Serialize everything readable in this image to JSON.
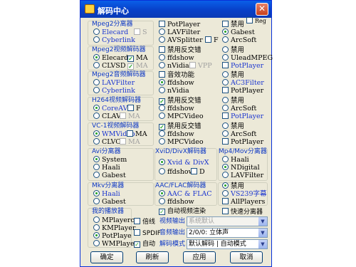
{
  "window": {
    "title": "解码中心",
    "reg": "Reg"
  },
  "g1": {
    "title": "Mpeg2分离器",
    "items": [
      "Elecard",
      "Cyberlink"
    ],
    "s": "S"
  },
  "g1b": {
    "items": [
      "PotPlayer",
      "LAVFilter",
      "AVSplitter"
    ],
    "f": "F"
  },
  "g1c": {
    "items": [
      "禁用",
      "Gabest",
      "ArcSoft"
    ]
  },
  "g2": {
    "title": "Mpeg2视频解码器",
    "items": [
      "Elecard",
      "CLVSD"
    ],
    "ma": "MA"
  },
  "g2b": {
    "items": [
      "禁用反交错",
      "ffdshow",
      "nVidia"
    ],
    "vpp": "VPP"
  },
  "g2c": {
    "items": [
      "禁用",
      "UleadMPEG",
      "PotPlayer"
    ]
  },
  "g3": {
    "title": "Mpeg2音频解码器",
    "items": [
      "LAVFilter",
      "Cyberlink"
    ]
  },
  "g3b": {
    "items": [
      "音效功能",
      "ffdshow",
      "nVidia"
    ]
  },
  "g3c": {
    "items": [
      "禁用",
      "AC3Filter",
      "PotPlayer"
    ]
  },
  "g4": {
    "title": "H264视频解码器",
    "items": [
      "CoreAVC",
      "CLAVC"
    ],
    "f": "F",
    "ma": "MA"
  },
  "g4b": {
    "items": [
      "禁用反交错",
      "ffdshow",
      "MPCVideo"
    ]
  },
  "g4c": {
    "items": [
      "禁用",
      "ArcSoft",
      "PotPlayer"
    ]
  },
  "g5": {
    "title": "VC-1视频解码器",
    "items": [
      "WMVideo",
      "CLVC1"
    ],
    "ma": "MA"
  },
  "g5b": {
    "items": [
      "禁用反交错",
      "ffdshow",
      "MPCVideo"
    ]
  },
  "g5c": {
    "items": [
      "禁用",
      "ArcSoft",
      "PotPlayer"
    ]
  },
  "g6": {
    "title": "Avi分离器",
    "items": [
      "System",
      "Haali",
      "Gabest"
    ]
  },
  "g7": {
    "title": "XviD/DivX解码器",
    "items": [
      "Xvid & DivX",
      "ffdshow"
    ],
    "d": "D"
  },
  "g8": {
    "title": "Mp4/Mov分离器",
    "items": [
      "Haali",
      "NDigital",
      "LAVFilter"
    ]
  },
  "g9": {
    "title": "Mkv分离器",
    "items": [
      "Haali",
      "Gabest"
    ]
  },
  "g10": {
    "title": "AAC/FLAC解码器",
    "items": [
      "AAC & FLAC",
      "ffdshow"
    ]
  },
  "g11": {
    "items": [
      "禁用",
      "VS239字幕",
      "AllPlayers"
    ]
  },
  "g12": {
    "title": "我的播放器",
    "items": [
      "MPlayerc",
      "KMPlayer",
      "PotPlaye",
      "WMPlayer"
    ]
  },
  "opts": {
    "auto_render": "自动视频渲染",
    "fast_split": "快速分离器",
    "double": "倍线",
    "spdif": "SPDIF",
    "auto": "自动",
    "video_out": "视频输出",
    "audio_out": "音频输出",
    "decode_mode": "解码模式"
  },
  "selects": {
    "video_out": "系统默认",
    "audio_out": "2/0/0: 立体声",
    "decode_mode": "默认解码 | 自动模式"
  },
  "buttons": {
    "ok": "确定",
    "refresh": "刷新",
    "apply": "应用",
    "cancel": "取消"
  }
}
